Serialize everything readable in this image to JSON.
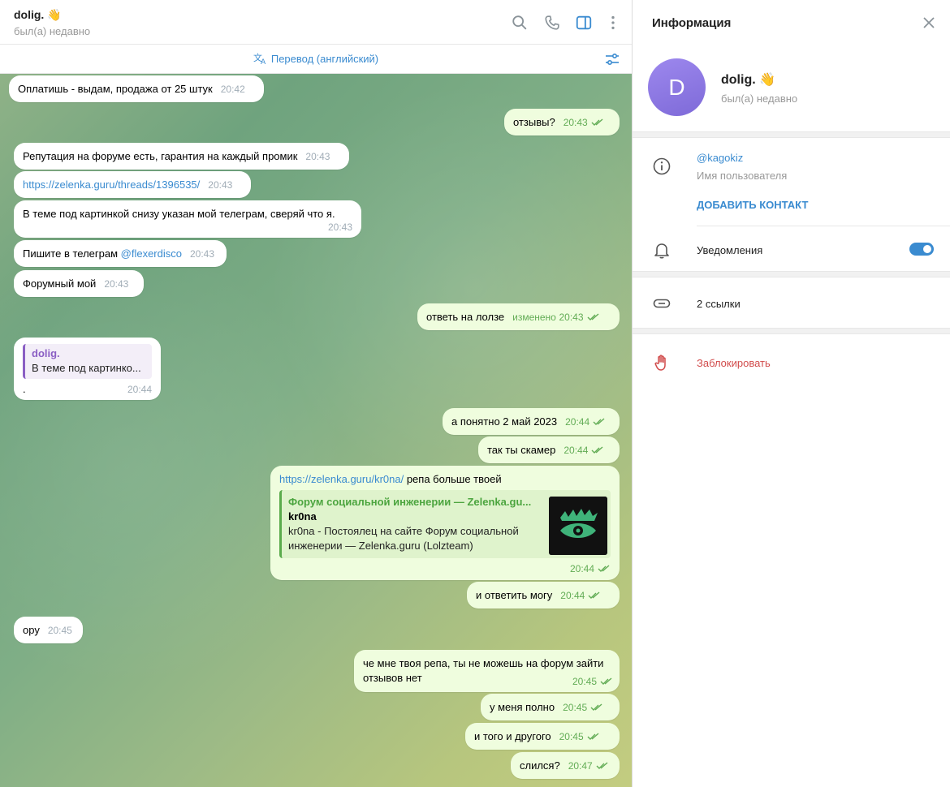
{
  "chat": {
    "name": "dolig. 👋",
    "status": "был(а) недавно",
    "translate_label": "Перевод (английский)",
    "icons": [
      "search-icon",
      "phone-icon",
      "sidebar-icon",
      "more-vertical-icon",
      "translate-icon",
      "filter-settings-icon"
    ]
  },
  "messages": [
    {
      "dir": "in",
      "text": "Оплатишь - выдам, продажа от 25 штук",
      "time": "20:42"
    },
    {
      "dir": "out",
      "text": "отзывы?",
      "time": "20:43"
    },
    {
      "dir": "in",
      "text": "Репутация на форуме есть, гарантия на каждый промик",
      "time": "20:43"
    },
    {
      "dir": "in",
      "link": "https://zelenka.guru/threads/1396535/",
      "time": "20:43"
    },
    {
      "dir": "in",
      "text": "В теме под картинкой снизу указан мой телеграм, сверяй что я.",
      "time": "20:43"
    },
    {
      "dir": "in",
      "text": "Пишите в телеграм ",
      "mention": "@flexerdisco",
      "time": "20:43"
    },
    {
      "dir": "in",
      "text": "Форумный мой",
      "time": "20:43"
    },
    {
      "dir": "out",
      "text": "ответь на лолзе",
      "edited": "изменено",
      "time": "20:43"
    },
    {
      "dir": "in",
      "reply_author": "dolig.",
      "reply_text": "В теме под картинко...",
      "text": ".",
      "time": "20:44"
    },
    {
      "dir": "out",
      "text": "а понятно 2 май 2023",
      "time": "20:44"
    },
    {
      "dir": "out",
      "text": "так ты скамер",
      "time": "20:44"
    },
    {
      "dir": "out",
      "link": "https://zelenka.guru/kr0na/",
      "text": " репа больше твоей",
      "time": "20:44",
      "preview": {
        "site": "Форум социальной инженерии — Zelenka.gu...",
        "title": "kr0na",
        "desc": "kr0na - Постоялец на сайте Форум социальной инженерии — Zelenka.guru (Lolzteam)"
      }
    },
    {
      "dir": "out",
      "text": "и ответить могу",
      "time": "20:44"
    },
    {
      "dir": "in",
      "text": "ору",
      "time": "20:45"
    },
    {
      "dir": "out",
      "text": "че мне твоя репа, ты не можешь на форум зайти",
      "text2": "отзывов нет",
      "time": "20:45"
    },
    {
      "dir": "out",
      "text": "у меня полно",
      "time": "20:45"
    },
    {
      "dir": "out",
      "text": "и того и другого",
      "time": "20:45"
    },
    {
      "dir": "out",
      "text": "слился?",
      "time": "20:47"
    }
  ],
  "info": {
    "title": "Информация",
    "avatar_letter": "D",
    "name": "dolig. 👋",
    "status": "был(а) недавно",
    "username": "@kagokiz",
    "username_caption": "Имя пользователя",
    "add_contact": "ДОБАВИТЬ КОНТАКТ",
    "notifications": "Уведомления",
    "notifications_on": true,
    "links": "2 ссылки",
    "block": "Заблокировать"
  },
  "colors": {
    "accent": "#3a8bd0",
    "outgoing_bubble": "#effdde",
    "incoming_bubble": "#ffffff",
    "danger": "#d14b4b",
    "avatar": "#8b76e2"
  }
}
